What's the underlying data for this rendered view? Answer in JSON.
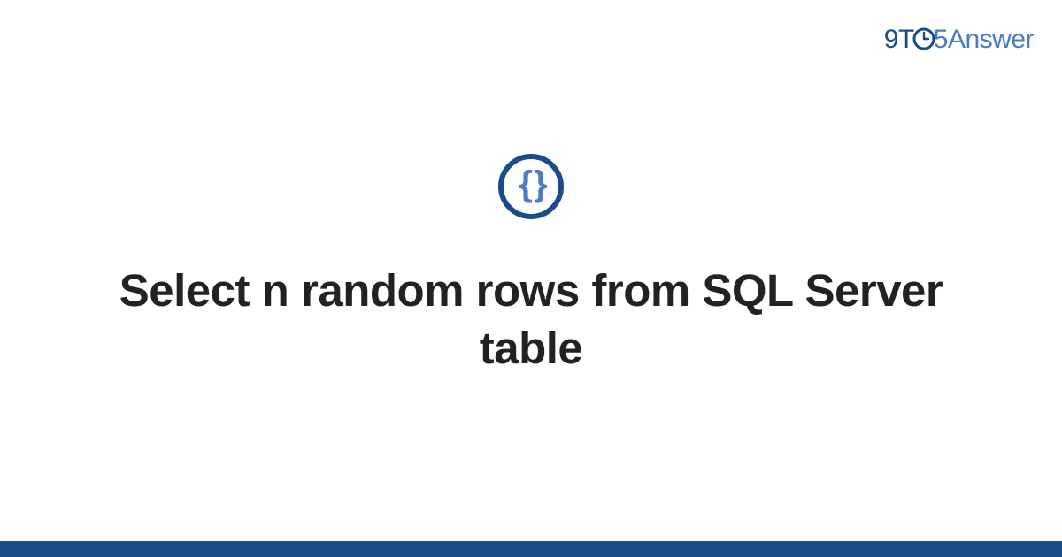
{
  "brand": {
    "part1": "9T",
    "part2": "5Answer"
  },
  "icon": {
    "symbol": "{ }",
    "name": "code-braces"
  },
  "title": "Select n random rows from SQL Server table",
  "colors": {
    "darkBlue": "#1b4b8a",
    "lightBlue": "#4a7bc4",
    "text": "#222222"
  }
}
